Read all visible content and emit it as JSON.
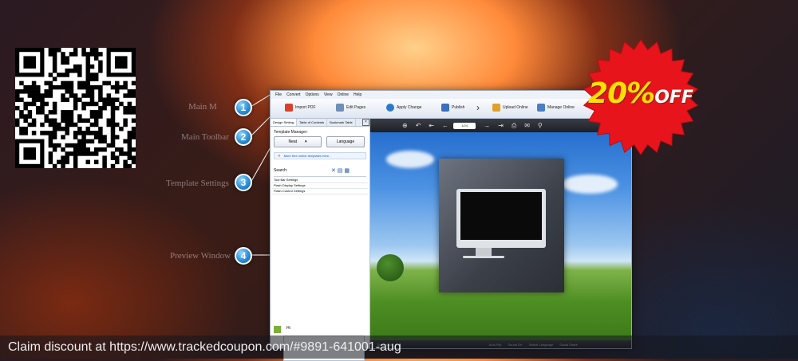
{
  "qr": {
    "icon": "qr-code-icon"
  },
  "callouts": [
    {
      "num": "1",
      "label": "Main M"
    },
    {
      "num": "2",
      "label": "Main Toolbar"
    },
    {
      "num": "3",
      "label": "Template Settings"
    },
    {
      "num": "4",
      "label": "Preview Window"
    }
  ],
  "app": {
    "menu": [
      "File",
      "Convert",
      "Options",
      "View",
      "Online",
      "Help"
    ],
    "toolbar": [
      {
        "label": "Import PDF",
        "icon": "import-pdf-icon",
        "color": "#d9412b"
      },
      {
        "label": "Edit Pages",
        "icon": "edit-pages-icon",
        "color": "#6e8fb8"
      },
      {
        "label": "Apply Change",
        "icon": "apply-change-icon",
        "color": "#2f78c9"
      },
      {
        "label": "Publish",
        "icon": "publish-icon",
        "color": "#3b6fbf"
      },
      {
        "label": "Upload Online",
        "icon": "upload-online-icon",
        "color": "#e0a12a"
      },
      {
        "label": "Manage Online",
        "icon": "manage-online-icon",
        "color": "#4a7fc1"
      }
    ],
    "tabs": [
      "Design Setting",
      "Table of Contents",
      "Bookmark Table"
    ],
    "template_manager": "Template Manager:",
    "template_name": "Neat",
    "language_btn": "Language",
    "more_templates": "More free online templates here...",
    "search_label": "Search:",
    "settings": [
      "Tool Bar Settings",
      "Flash Display Settings",
      "Flash Control Settings"
    ],
    "help_label": "Hi",
    "preview_page": "1/24",
    "preview_status": [
      "Thumbnails",
      "Auto Flip",
      "Sound On",
      "Switch Language",
      "Social Share"
    ]
  },
  "badge": {
    "percent": "20%",
    "off": "OFF",
    "color": "#e8141b"
  },
  "claim_text": "Claim discount at https://www.trackedcoupon.com/#9891-641001-aug"
}
